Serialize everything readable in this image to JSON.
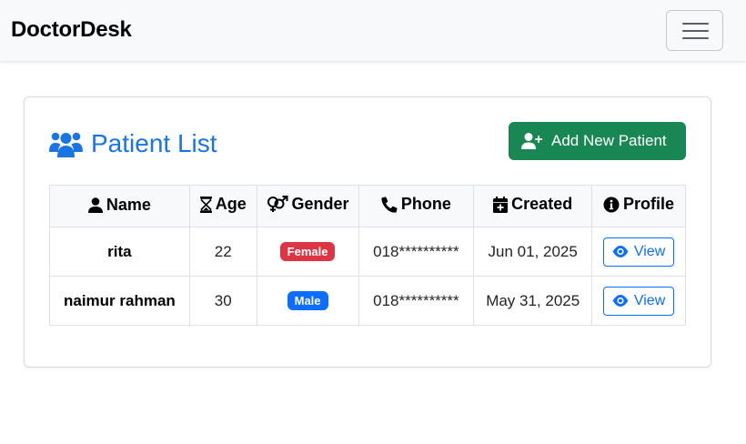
{
  "navbar": {
    "brand": "DoctorDesk",
    "toggler_icon": "hamburger-icon"
  },
  "card": {
    "title": "Patient List",
    "title_icon": "users-icon",
    "add_button": {
      "label": "Add New Patient",
      "icon": "user-plus-icon"
    }
  },
  "table": {
    "headers": [
      {
        "label": "Name",
        "icon": "user-icon"
      },
      {
        "label": "Age",
        "icon": "hourglass-icon"
      },
      {
        "label": "Gender",
        "icon": "venus-mars-icon"
      },
      {
        "label": "Phone",
        "icon": "phone-icon"
      },
      {
        "label": "Created",
        "icon": "calendar-plus-icon"
      },
      {
        "label": "Profile",
        "icon": "info-circle-icon"
      }
    ],
    "rows": [
      {
        "name": "rita",
        "age": "22",
        "gender": "Female",
        "phone": "018**********",
        "created": "Jun 01, 2025",
        "action": "View"
      },
      {
        "name": "naimur rahman",
        "age": "30",
        "gender": "Male",
        "phone": "018**********",
        "created": "May 31, 2025",
        "action": "View"
      }
    ]
  },
  "colors": {
    "primary": "#1b74e4",
    "success": "#198754",
    "female_badge": "#dc3545",
    "male_badge": "#0d6efd"
  }
}
